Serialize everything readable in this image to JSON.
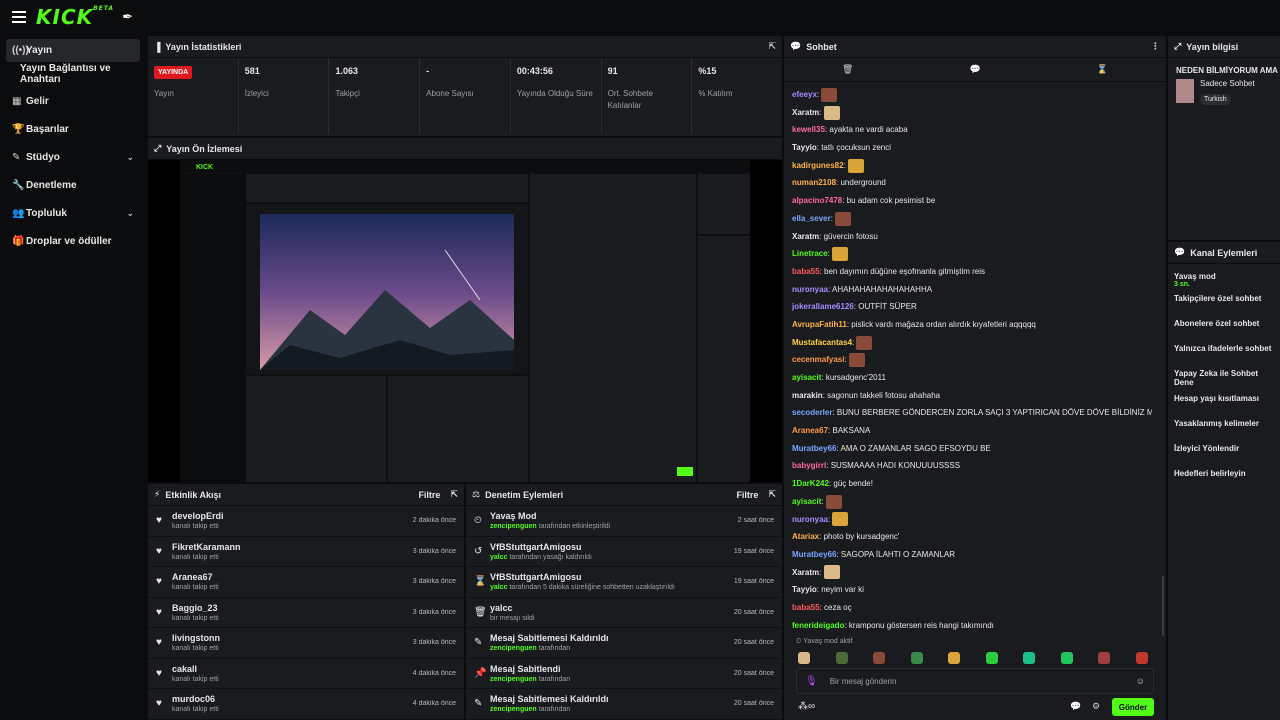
{
  "brand": {
    "logo": "KICK",
    "logo_sup": "BETA"
  },
  "sidebar": {
    "items": [
      {
        "label": "Yayın",
        "icon": "broadcast-icon",
        "glyph": "((•))"
      },
      {
        "label": "Yayın Bağlantısı ve Anahtarı",
        "sub": true
      },
      {
        "label": "Gelir",
        "icon": "bar-chart-icon",
        "glyph": "▦"
      },
      {
        "label": "Başarılar",
        "icon": "trophy-icon",
        "glyph": "🏆"
      },
      {
        "label": "Stüdyo",
        "icon": "brush-icon",
        "glyph": "✎",
        "chev": true
      },
      {
        "label": "Denetleme",
        "icon": "wrench-icon",
        "glyph": "🔧"
      },
      {
        "label": "Topluluk",
        "icon": "users-icon",
        "glyph": "👥",
        "chev": true
      },
      {
        "label": "Droplar ve ödüller",
        "icon": "gift-icon",
        "glyph": "🎁"
      }
    ]
  },
  "stats": {
    "title": "Yayın İstatistikleri",
    "live_badge": "YAYINDA",
    "live_label": "Yayın",
    "items": [
      {
        "value": "581",
        "label": "İzleyici"
      },
      {
        "value": "1.063",
        "label": "Takipçi"
      },
      {
        "value": "-",
        "label": "Abone Sayısı"
      },
      {
        "value": "00:43:56",
        "label": "Yayında Olduğu Süre"
      },
      {
        "value": "91",
        "label": "Ort. Sohbete Katılanlar"
      },
      {
        "value": "%15",
        "label": "% Katılım"
      }
    ]
  },
  "preview": {
    "title": "Yayın Ön İzlemesi"
  },
  "activity": {
    "title": "Etkinlik Akışı",
    "filter": "Filtre",
    "rows": [
      {
        "name": "developErdi",
        "sub": "kanalı takip etti",
        "time": "2 dakika önce"
      },
      {
        "name": "FikretKaramann",
        "sub": "kanalı takip etti",
        "time": "3 dakika önce"
      },
      {
        "name": "Aranea67",
        "sub": "kanalı takip etti",
        "time": "3 dakika önce"
      },
      {
        "name": "Baggio_23",
        "sub": "kanalı takip etti",
        "time": "3 dakika önce"
      },
      {
        "name": "livingstonn",
        "sub": "kanalı takip etti",
        "time": "3 dakika önce"
      },
      {
        "name": "cakall",
        "sub": "kanalı takip etti",
        "time": "4 dakika önce"
      },
      {
        "name": "murdoc06",
        "sub": "kanalı takip etti",
        "time": "4 dakika önce"
      }
    ]
  },
  "moderation": {
    "title": "Denetim Eylemleri",
    "filter": "Filtre",
    "rows": [
      {
        "icon": "slow-mode-icon",
        "glyph": "⏲",
        "name": "Yavaş Mod",
        "user": "zencipenguen",
        "sub": " tarafından etkinleştirildi",
        "time": "2 saat önce"
      },
      {
        "icon": "undo-icon",
        "glyph": "↺",
        "name": "VfBStuttgartAmigosu",
        "user": "yalcc",
        "sub": " tarafından yasağı kaldırıldı",
        "time": "19 saat önce"
      },
      {
        "icon": "hourglass-icon",
        "glyph": "⌛",
        "name": "VfBStuttgartAmigosu",
        "user": "yalcc",
        "sub": " tarafından 5 dakika süreliğine sohbetten uzaklaştırıldı",
        "time": "19 saat önce"
      },
      {
        "icon": "trash-icon",
        "glyph": "🗑",
        "name": "yalcc",
        "user": "",
        "sub": "bir mesajı sildi",
        "time": "20 saat önce"
      },
      {
        "icon": "unpin-icon",
        "glyph": "✎",
        "name": "Mesaj Sabitlemesi Kaldırıldı",
        "user": "zencipenguen",
        "sub": " tarafından",
        "time": "20 saat önce"
      },
      {
        "icon": "pin-icon",
        "glyph": "📌",
        "name": "Mesaj Sabitlendi",
        "user": "zencipenguen",
        "sub": " tarafından",
        "time": "20 saat önce"
      },
      {
        "icon": "unpin-icon",
        "glyph": "✎",
        "name": "Mesaj Sabitlemesi Kaldırıldı",
        "user": "zencipenguen",
        "sub": " tarafından",
        "time": "20 saat önce"
      }
    ]
  },
  "chat": {
    "title": "Sohbet",
    "slow_mode": "Yavaş mod aktif",
    "placeholder": "Bir mesaj gönderin",
    "send": "Gönder",
    "messages": [
      {
        "user": "efeeyx",
        "color": "#a98bff",
        "text": "",
        "emote": "#8a4a3a"
      },
      {
        "user": "Xaratm",
        "color": "#e6e7e8",
        "text": "",
        "emote": "#d9b98a"
      },
      {
        "user": "kewell35",
        "color": "#ff6b9a",
        "text": "ayakta ne vardi acaba"
      },
      {
        "user": "Tayyio",
        "color": "#e6e7e8",
        "text": "tatlı çocuksun zenci"
      },
      {
        "user": "kadirgunes82",
        "color": "#ffb347",
        "text": "",
        "emote": "#d9a43a"
      },
      {
        "user": "numan2108",
        "color": "#ffb347",
        "text": "underground"
      },
      {
        "user": "alpacino7478",
        "color": "#ff6b9a",
        "text": "bu adam cok pesimist be"
      },
      {
        "user": "ella_sever",
        "color": "#7ba7ff",
        "text": "",
        "emote": "#8a4a3a"
      },
      {
        "user": "Xaratm",
        "color": "#e6e7e8",
        "text": "güvercin fotosu"
      },
      {
        "user": "Linetrace",
        "color": "#53fc18",
        "text": "",
        "emote": "#d9a43a"
      },
      {
        "user": "baba55",
        "color": "#ff5a5a",
        "text": "ben dayımın düğüne eşofmanla gitmiştim reis"
      },
      {
        "user": "nuronyaa",
        "color": "#a98bff",
        "text": "AHAHAHAHAHAHAHAHHA"
      },
      {
        "user": "jokerallame6126",
        "color": "#a98bff",
        "text": "OUTFİT SÜPER"
      },
      {
        "user": "AvrupaFatih11",
        "color": "#ffb347",
        "text": "pislick vardı mağaza ordan alırdık kıyafetleri aqqqqq"
      },
      {
        "user": "Mustafacantas4",
        "color": "#ffd23f",
        "text": "",
        "emote": "#8a4a3a"
      },
      {
        "user": "cecenmafyasi",
        "color": "#ff9a3f",
        "text": "",
        "emote": "#8a4a3a"
      },
      {
        "user": "ayisacit",
        "color": "#53fc18",
        "text": "kursadgenc'2011"
      },
      {
        "user": "marakin",
        "color": "#e6e7e8",
        "text": "sagonun takkeli fotosu ahahaha"
      },
      {
        "user": "secoderler",
        "color": "#7ba7ff",
        "text": "BUNU BERBERE GÖNDERCEN ZORLA SAÇI 3 YAPTIRICAN DÖVE DÖVE BİLDİNİZ Mİ"
      },
      {
        "user": "Aranea67",
        "color": "#ff9a3f",
        "text": "BAKSANA"
      },
      {
        "user": "Muratbey66",
        "color": "#7ba7ff",
        "text": "AMA O ZAMANLAR SAGO EFSOYDU BE"
      },
      {
        "user": "babygirrl",
        "color": "#ff6b9a",
        "text": "SUSMAAAA HADI KONUUUUSSSS"
      },
      {
        "user": "1DarK242",
        "color": "#53fc18",
        "text": "güç bende!"
      },
      {
        "user": "ayisacit",
        "color": "#53fc18",
        "text": "",
        "emote": "#8a4a3a"
      },
      {
        "user": "nuronyaa",
        "color": "#a98bff",
        "text": "",
        "emote": "#d9a43a"
      },
      {
        "user": "Atariax",
        "color": "#ffb347",
        "text": "photo by kursadgenc'"
      },
      {
        "user": "Muratbey66",
        "color": "#7ba7ff",
        "text": "SAGOPA İLAHTI O ZAMANLAR"
      },
      {
        "user": "Xaratm",
        "color": "#e6e7e8",
        "text": "",
        "emote": "#d9b98a"
      },
      {
        "user": "Tayyio",
        "color": "#e6e7e8",
        "text": "neyim var ki"
      },
      {
        "user": "baba55",
        "color": "#ff5a5a",
        "text": "ceza oç"
      },
      {
        "user": "fenerideigado",
        "color": "#53fc18",
        "text": "kramponu göstersen reis hangi takımındı"
      }
    ]
  },
  "stream_info": {
    "title": "Yayın bilgisi",
    "stream_title": "NEDEN BİLMİYORUM AMA",
    "category": "Sadece Sohbet",
    "tag": "Turkish"
  },
  "channel_actions": {
    "title": "Kanal Eylemleri",
    "slow_mode": "Yavaş mod",
    "slow_mode_value": "3 sn.",
    "items": [
      "Takipçilere özel sohbet",
      "Abonelere özel sohbet",
      "Yalnızca ifadelerle sohbet",
      "Yapay Zeka ile Sohbet Dene",
      "Hesap yaşı kısıtlaması",
      "Yasaklanmış kelimeler",
      "İzleyici Yönlendir",
      "Hedefleri belirleyin"
    ]
  },
  "colors": {
    "brand": "#53fc18",
    "live": "#e0191f",
    "panel": "#191b1f",
    "bg": "#0b0c0d"
  }
}
